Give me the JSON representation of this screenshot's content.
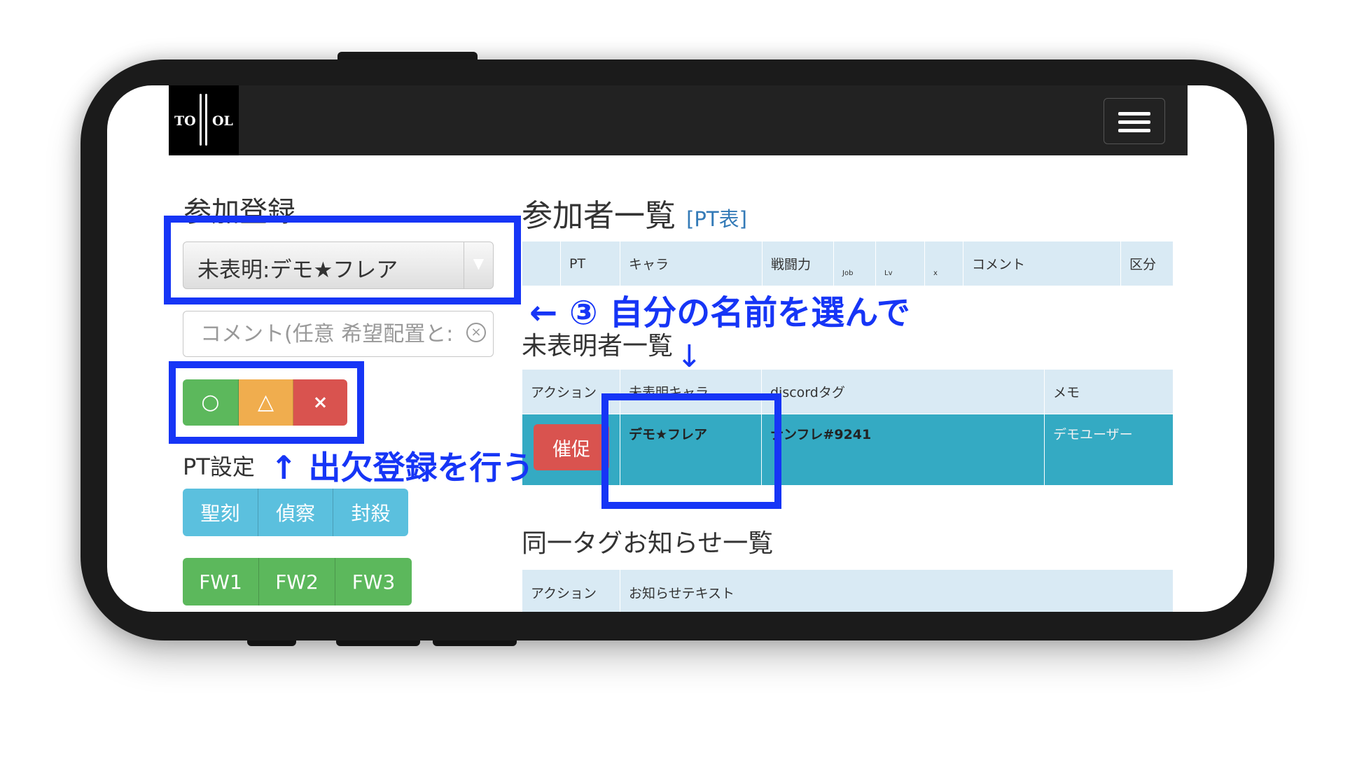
{
  "navbar": {
    "logo_left": "TO",
    "logo_right": "OL"
  },
  "left": {
    "heading": "参加登録",
    "select_value": "未表明:デモ★フレア",
    "comment_placeholder": "コメント(任意 希望配置と:",
    "attendance_buttons": [
      "○",
      "△",
      "×"
    ],
    "pt_heading": "PT設定",
    "role_buttons": [
      "聖刻",
      "偵察",
      "封殺"
    ],
    "fw_buttons": [
      "FW1",
      "FW2",
      "FW3"
    ]
  },
  "right": {
    "participants_heading": "参加者一覧",
    "pt_link": "[PT表]",
    "participants_columns": [
      "PT",
      "キャラ",
      "戦闘力",
      "Job",
      "Lv",
      "x",
      "コメント",
      "区分"
    ],
    "undeclared_heading": "未表明者一覧",
    "undeclared_columns": [
      "アクション",
      "未表明キャラ",
      "discordタグ",
      "メモ"
    ],
    "undeclared_rows": [
      {
        "action": "催促",
        "character": "デモ★フレア",
        "discord": "ナンフレ#9241",
        "memo": "デモユーザー"
      }
    ],
    "same_tag_heading": "同一タグお知らせ一覧",
    "same_tag_columns": [
      "アクション",
      "お知らせテキスト"
    ]
  },
  "annotations": {
    "step3": "← ③ 自分の名前を選んで",
    "down_arrow": "↓",
    "attendance": "↑ 出欠登録を行う"
  },
  "colors": {
    "navbar": "#222222",
    "success": "#5cb85c",
    "warning": "#f0ad4e",
    "danger": "#d9534f",
    "info": "#5bc0de",
    "row_highlight": "#34aac3",
    "table_header": "#d9eaf4",
    "annotation": "#1635f6"
  }
}
